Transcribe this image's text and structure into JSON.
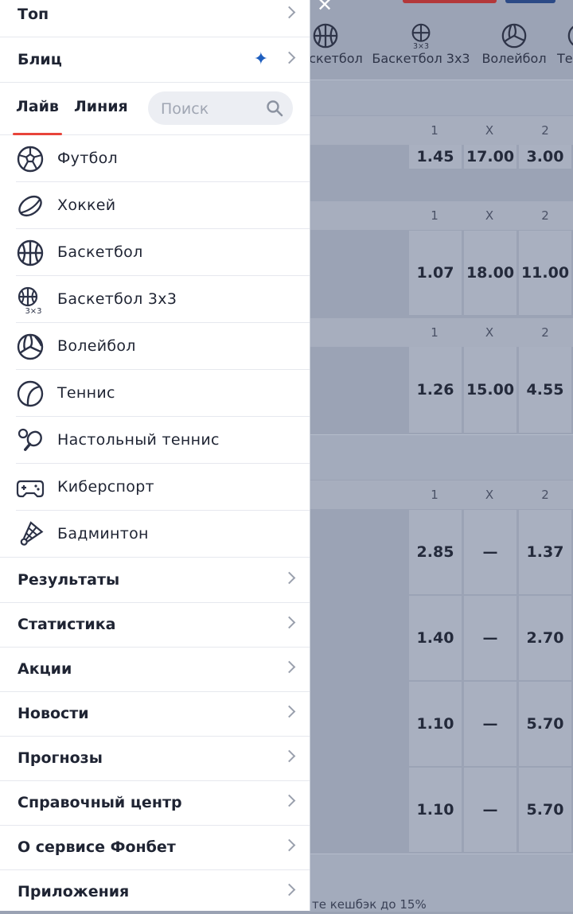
{
  "background": {
    "sport_tabs": [
      {
        "label": "скетбол",
        "icon": "basketball-icon"
      },
      {
        "label": "Баскетбол 3x3",
        "icon": "basketball-3x3-icon"
      },
      {
        "label": "Волейбол",
        "icon": "volleyball-icon"
      },
      {
        "label": "Те",
        "icon": "tennis-icon"
      }
    ],
    "col_headers": [
      "1",
      "X",
      "2"
    ],
    "odds_rows": [
      [
        "1.45",
        "17.00",
        "3.00"
      ],
      [
        "1.07",
        "18.00",
        "11.00"
      ],
      [
        "1.26",
        "15.00",
        "4.55"
      ],
      [
        "2.85",
        "—",
        "1.37"
      ],
      [
        "1.40",
        "—",
        "2.70"
      ],
      [
        "1.10",
        "—",
        "5.70"
      ],
      [
        "1.10",
        "—",
        "5.70"
      ]
    ],
    "bottom_text": "те кешбэк до 15%"
  },
  "drawer": {
    "top_items": [
      {
        "label": "Топ"
      },
      {
        "label": "Блиц",
        "icon": "sparkle-icon"
      }
    ],
    "tabs": [
      {
        "label": "Лайв",
        "active": true
      },
      {
        "label": "Линия",
        "active": false
      }
    ],
    "search": {
      "placeholder": "Поиск",
      "icon": "search-icon"
    },
    "sports": [
      {
        "label": "Футбол",
        "icon": "football-icon"
      },
      {
        "label": "Хоккей",
        "icon": "hockey-puck-icon"
      },
      {
        "label": "Баскетбол",
        "icon": "basketball-icon"
      },
      {
        "label": "Баскетбол 3x3",
        "icon": "basketball-3x3-icon"
      },
      {
        "label": "Волейбол",
        "icon": "volleyball-icon"
      },
      {
        "label": "Теннис",
        "icon": "tennis-icon"
      },
      {
        "label": "Настольный теннис",
        "icon": "table-tennis-icon"
      },
      {
        "label": "Киберспорт",
        "icon": "gamepad-icon"
      },
      {
        "label": "Бадминтон",
        "icon": "shuttlecock-icon"
      }
    ],
    "menu_items": [
      {
        "label": "Результаты"
      },
      {
        "label": "Статистика"
      },
      {
        "label": "Акции"
      },
      {
        "label": "Новости"
      },
      {
        "label": "Прогнозы"
      },
      {
        "label": "Справочный центр"
      },
      {
        "label": "О сервисе Фонбет"
      },
      {
        "label": "Приложения"
      }
    ]
  },
  "colors": {
    "accent": "#e8443a",
    "blitz": "#1f5fbf",
    "overlay": "#9ba3b5"
  }
}
